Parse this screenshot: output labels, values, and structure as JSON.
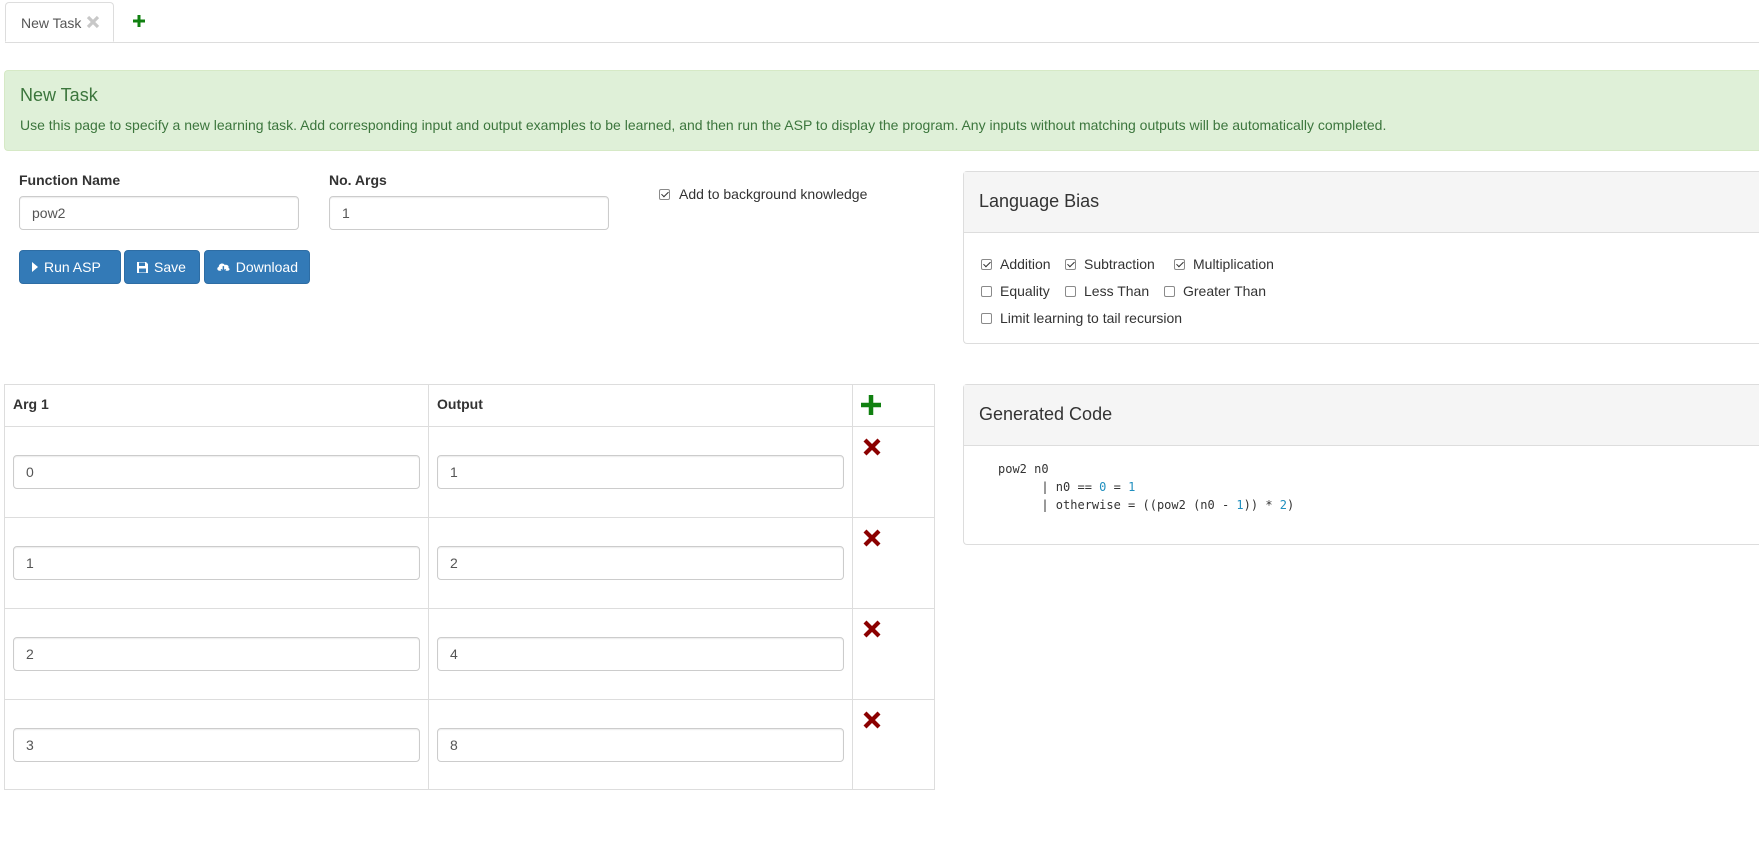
{
  "tabs": [
    {
      "label": "New Task"
    }
  ],
  "alert": {
    "title": "New Task",
    "text": "Use this page to specify a new learning task. Add corresponding input and output examples to be learned, and then run the ASP to display the program. Any inputs without matching outputs will be automatically completed."
  },
  "form": {
    "function_name_label": "Function Name",
    "function_name_value": "pow2",
    "no_args_label": "No. Args",
    "no_args_value": "1",
    "background_label": "Add to background knowledge",
    "background_checked": true
  },
  "buttons": {
    "run": "Run ASP",
    "save": "Save",
    "download": "Download"
  },
  "language_bias": {
    "title": "Language Bias",
    "options": [
      {
        "label": "Addition",
        "checked": true
      },
      {
        "label": "Subtraction",
        "checked": true
      },
      {
        "label": "Multiplication",
        "checked": true
      },
      {
        "label": "Equality",
        "checked": false
      },
      {
        "label": "Less Than",
        "checked": false
      },
      {
        "label": "Greater Than",
        "checked": false
      },
      {
        "label": "Limit learning to tail recursion",
        "checked": false
      }
    ]
  },
  "generated_code": {
    "title": "Generated Code",
    "lines": [
      "pow2 n0",
      "      | n0 == 0 = 1",
      "      | otherwise = ((pow2 (n0 - 1)) * 2)"
    ]
  },
  "examples": {
    "headers": [
      "Arg 1",
      "Output"
    ],
    "rows": [
      {
        "arg": "0",
        "output": "1"
      },
      {
        "arg": "1",
        "output": "2"
      },
      {
        "arg": "2",
        "output": "4"
      },
      {
        "arg": "3",
        "output": "8"
      }
    ]
  },
  "colors": {
    "add": "#108010",
    "delete": "#8b0000",
    "primary": "#337ab7",
    "success_bg": "#dff0d8"
  }
}
